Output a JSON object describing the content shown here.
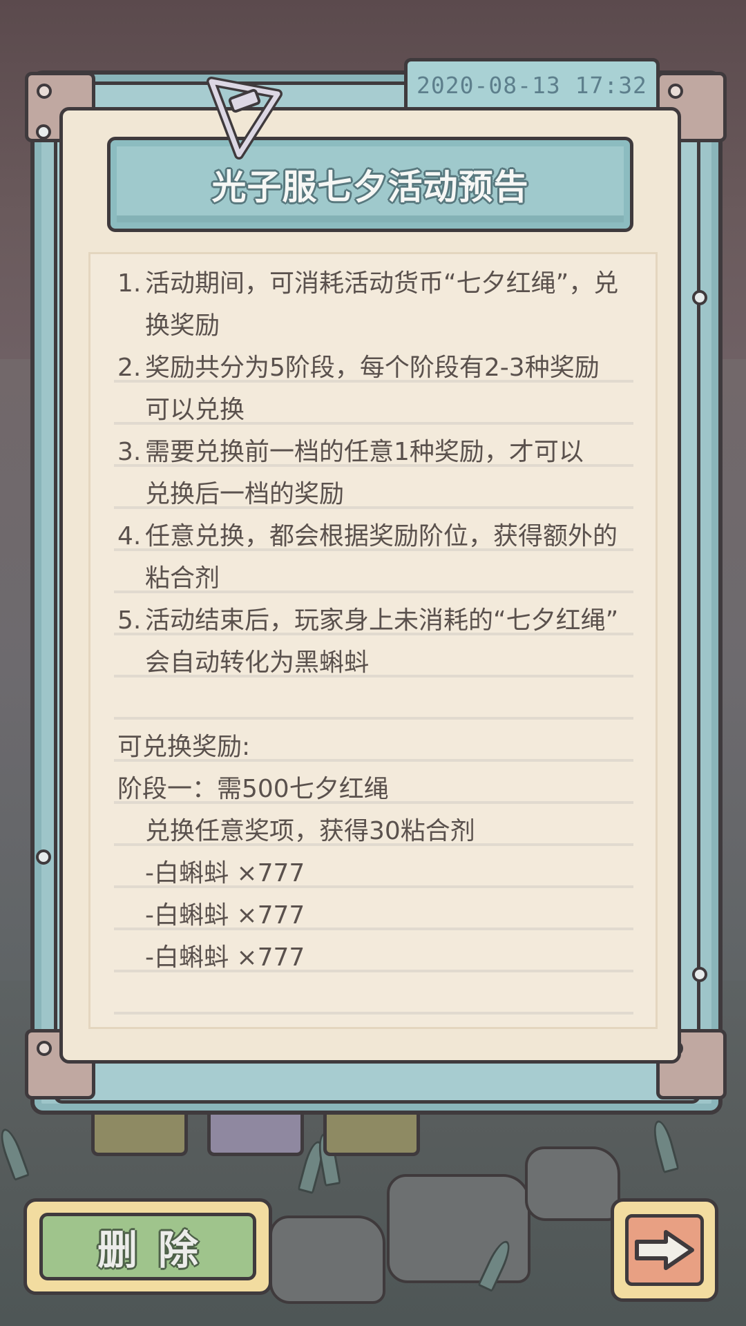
{
  "notice": {
    "timestamp": "2020-08-13  17:32",
    "title": "光子服七夕活动预告",
    "rules": [
      {
        "num": "1.",
        "lines": [
          "活动期间，可消耗活动货币“七夕红绳”，兑",
          "换奖励"
        ]
      },
      {
        "num": "2.",
        "lines": [
          "奖励共分为5阶段，每个阶段有2-3种奖励",
          "可以兑换"
        ]
      },
      {
        "num": "3.",
        "lines": [
          "需要兑换前一档的任意1种奖励，才可以",
          "兑换后一档的奖励"
        ]
      },
      {
        "num": "4.",
        "lines": [
          "任意兑换，都会根据奖励阶位，获得额外的",
          "粘合剂"
        ]
      },
      {
        "num": "5.",
        "lines": [
          "活动结束后，玩家身上未消耗的“七夕红绳”",
          "会自动转化为黑蝌蚪"
        ]
      }
    ],
    "rewards_heading": "可兑换奖励:",
    "stage_one": "阶段一：需500七夕红绳",
    "stage_one_note": "兑换任意奖项，获得30粘合剂",
    "reward_items": [
      "-白蝌蚪  ×777",
      "-白蝌蚪  ×777",
      "-白蝌蚪  ×777"
    ]
  },
  "buttons": {
    "delete_label": "删除",
    "next_icon": "arrow-right-icon"
  },
  "colors": {
    "paper": "#f1e7d5",
    "frame": "#9ec5c9",
    "delete_button": "#9fc48c",
    "next_button": "#e8a083"
  }
}
